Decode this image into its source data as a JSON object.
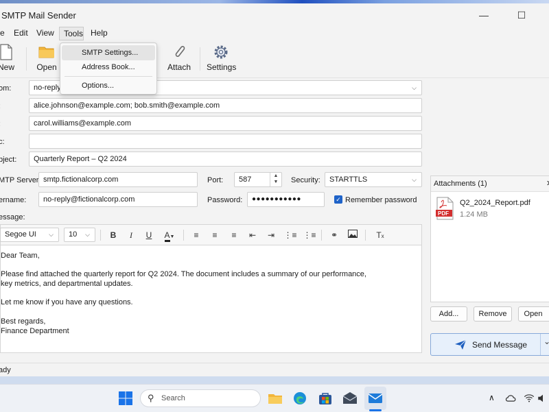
{
  "app": {
    "title": "SMTP Mail Sender"
  },
  "window_controls": {
    "minimize": "—",
    "maximize": "☐",
    "close": "✕"
  },
  "menu": [
    "e",
    "Edit",
    "View",
    "Tools",
    "Help"
  ],
  "tools_menu": {
    "items": [
      "SMTP Settings...",
      "Address Book...",
      "Options..."
    ],
    "highlighted": "SMTP Settings..."
  },
  "toolbar": {
    "new": "New",
    "open": "Open",
    "attach": "Attach",
    "settings": "Settings"
  },
  "form": {
    "from_label": "om:",
    "from_value": "no-reply",
    "to_label": ":",
    "to_value": "alice.johnson@example.com; bob.smith@example.com",
    "cc_label": ":",
    "cc_value": "carol.williams@example.com",
    "bcc_label": "c:",
    "bcc_value": "",
    "subject_label": "bject:",
    "subject_value": "Quarterly Report – Q2 2024"
  },
  "smtp": {
    "server_label": "MTP Server:",
    "server_value": "smtp.fictionalcorp.com",
    "port_label": "Port:",
    "port_value": "587",
    "security_label": "Security:",
    "security_value": "STARTTLS",
    "username_label": "ername:",
    "username_value": "no-reply@fictionalcorp.com",
    "password_label": "Password:",
    "password_value": "●●●●●●●●●●●",
    "remember_label": "Remember password",
    "remember_checked": true
  },
  "message_label": "essage:",
  "editor": {
    "font": "Segoe UI",
    "size": "10",
    "lines": [
      "Dear Team,",
      "Please find attached the quarterly report for Q2 2024. The document includes a summary of our performance,",
      "key metrics, and departmental updates.",
      "Let me know if you have any questions.",
      "Best regards,",
      "Finance Department"
    ]
  },
  "attachments": {
    "header": "Attachments (1)",
    "close": "✕",
    "file_name": "Q2_2024_Report.pdf",
    "file_size": "1.24 MB",
    "file_type": "PDF",
    "buttons": [
      "Add...",
      "Remove",
      "Open"
    ]
  },
  "send": {
    "label": "Send Message",
    "arrow": "⌄"
  },
  "status": "ady",
  "taskbar": {
    "search_placeholder": "Search",
    "tray_chevron": "∧"
  },
  "colors": {
    "accent": "#1f63c8",
    "pdf_red": "#d32f2f",
    "send_blue": "#1e5fbf"
  }
}
